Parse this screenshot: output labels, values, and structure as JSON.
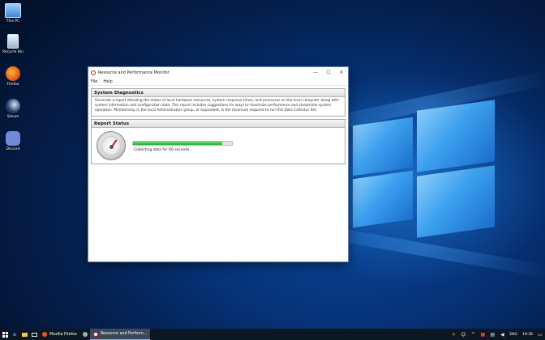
{
  "desktop_icons": [
    {
      "label": "This PC",
      "icon": "this-pc-icon"
    },
    {
      "label": "Recycle Bin",
      "icon": "recycle-bin-icon"
    },
    {
      "label": "Firefox",
      "icon": "firefox-icon"
    },
    {
      "label": "Steam",
      "icon": "steam-icon"
    },
    {
      "label": "Discord",
      "icon": "discord-icon"
    }
  ],
  "window": {
    "title": "Resource and Performance Monitor",
    "controls": {
      "minimize": "—",
      "maximize": "☐",
      "close": "✕"
    },
    "menu": [
      "File",
      "Help"
    ],
    "diagnostics": {
      "heading": "System Diagnostics",
      "description": "Generate a report detailing the status of local hardware resources, system response times, and processes on the local computer along with system information and configuration data. This report includes suggestions for ways to maximize performance and streamline system operation. Membership in the local Administrators group, or equivalent, is the minimum required to run this Data Collector Set."
    },
    "report_status": {
      "heading": "Report Status",
      "progress": 0.9,
      "status_text": "Collecting data for 60 seconds..."
    }
  },
  "taskbar": {
    "apps": [
      {
        "label": "Mozilla Firefox",
        "active": false,
        "icon": "firefox-icon"
      },
      {
        "label": "Resource and Perform...",
        "active": true,
        "icon": "perfmon-icon"
      }
    ],
    "language": "ENG",
    "clock": "19:36"
  }
}
